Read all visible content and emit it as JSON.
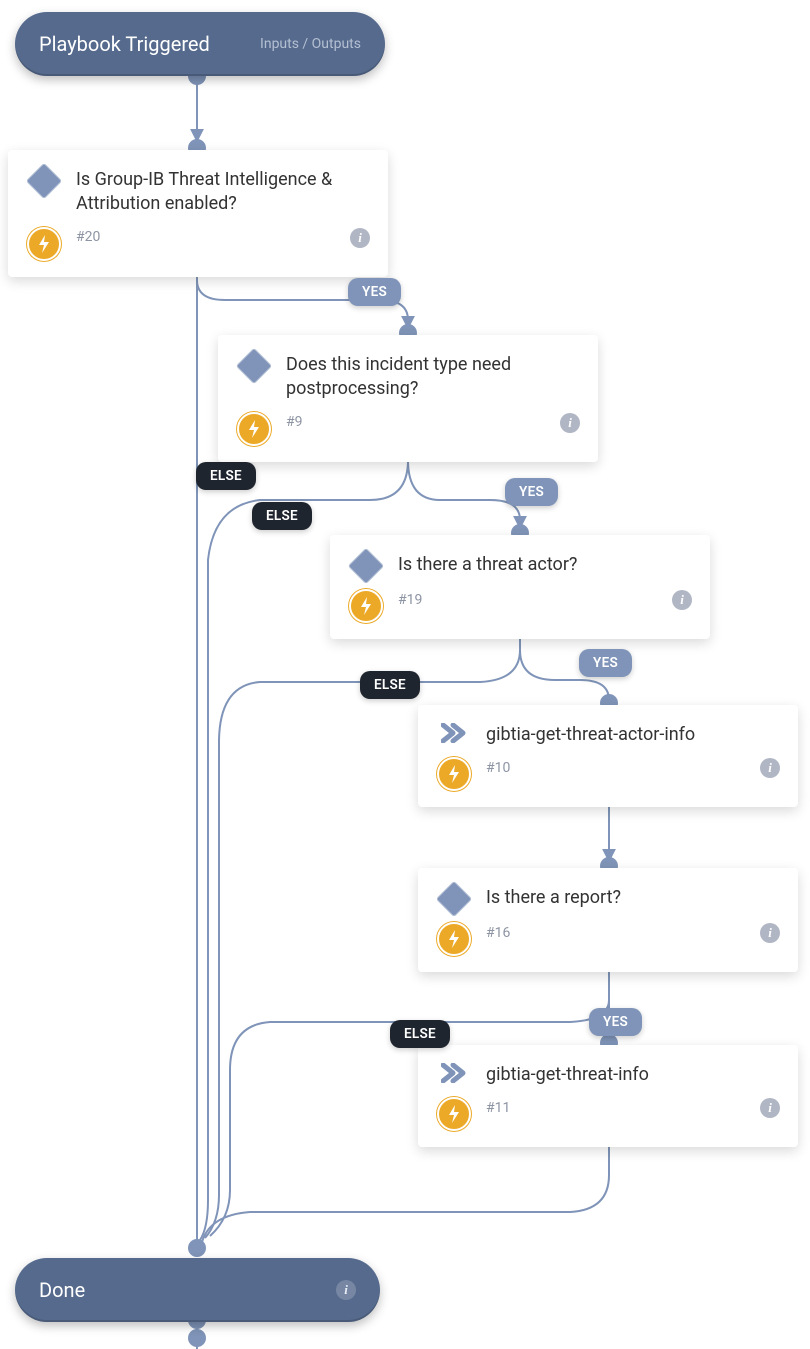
{
  "start": {
    "title": "Playbook Triggered",
    "io": "Inputs / Outputs"
  },
  "end": {
    "title": "Done"
  },
  "tags": {
    "yes": "YES",
    "else": "ELSE"
  },
  "nodes": {
    "n1": {
      "title": "Is Group-IB Threat Intelligence & Attribution enabled?",
      "id": "#20"
    },
    "n2": {
      "title": "Does this incident type need postprocessing?",
      "id": "#9"
    },
    "n3": {
      "title": "Is there a threat actor?",
      "id": "#19"
    },
    "n4": {
      "title": "gibtia-get-threat-actor-info",
      "id": "#10"
    },
    "n5": {
      "title": "Is there a report?",
      "id": "#16"
    },
    "n6": {
      "title": "gibtia-get-threat-info",
      "id": "#11"
    }
  }
}
